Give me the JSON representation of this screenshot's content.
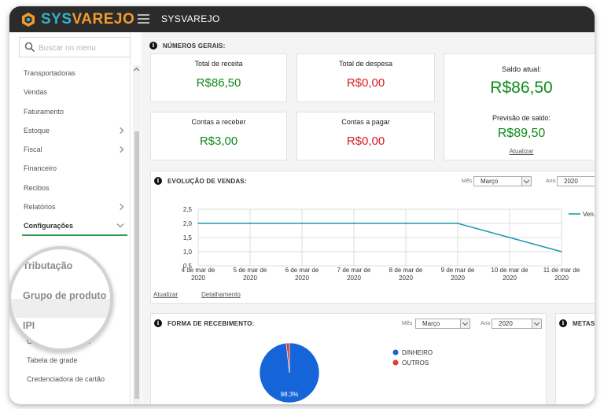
{
  "app": {
    "logo_part1": "SYS",
    "logo_part2": "VAREJO",
    "title": "SYSVAREJO"
  },
  "sidebar": {
    "search_placeholder": "Buscar no menu",
    "items": [
      {
        "label": "Transportadoras",
        "has_submenu": false
      },
      {
        "label": "Vendas",
        "has_submenu": false
      },
      {
        "label": "Faturamento",
        "has_submenu": false
      },
      {
        "label": "Estoque",
        "has_submenu": true
      },
      {
        "label": "Fiscal",
        "has_submenu": true
      },
      {
        "label": "Financeiro",
        "has_submenu": false
      },
      {
        "label": "Recibos",
        "has_submenu": false
      },
      {
        "label": "Relatórios",
        "has_submenu": true
      },
      {
        "label": "Configurações",
        "has_submenu": true,
        "active": true
      }
    ],
    "subitems": [
      {
        "label": "Categoria financeira"
      },
      {
        "label": "Tabela de grade"
      },
      {
        "label": "Credenciadora de cartão"
      }
    ],
    "magnified": [
      "Tributação",
      "Grupo de produto",
      "IPI"
    ]
  },
  "numeros_gerais": {
    "title": "NÚMEROS GERAIS:",
    "cards": {
      "total_receita": {
        "label": "Total de receita",
        "value": "R$86,50"
      },
      "total_despesa": {
        "label": "Total de despesa",
        "value": "R$0,00"
      },
      "contas_receber": {
        "label": "Contas a receber",
        "value": "R$3,00"
      },
      "contas_pagar": {
        "label": "Contas a pagar",
        "value": "R$0,00"
      }
    },
    "saldo": {
      "label": "Saldo atual:",
      "value": "R$86,50",
      "previsao_label": "Previsão de saldo:",
      "previsao_value": "R$89,50",
      "update_link": "Atualizar"
    },
    "colors": {
      "positive": "#0e8a1a",
      "negative": "#e0191e"
    }
  },
  "evolucao": {
    "title": "EVOLUÇÃO DE VENDAS:",
    "month_label": "Mês",
    "month_value": "Março",
    "year_label": "Ano",
    "year_value": "2020",
    "legend": "Ven...",
    "link_update": "Atualizar",
    "link_details": "Detalhamento"
  },
  "recebimento": {
    "title": "FORMA DE RECEBIMENTO:",
    "month_label": "Mês",
    "month_value": "Março",
    "year_label": "Ano",
    "year_value": "2020",
    "pie_label": "98.3%"
  },
  "metas": {
    "title": "METAS:"
  },
  "chart_data": [
    {
      "type": "line",
      "x": [
        "4 de mar de 2020",
        "5 de mar de 2020",
        "6 de mar de 2020",
        "7 de mar de 2020",
        "8 de mar de 2020",
        "9 de mar de 2020",
        "10 de mar de 2020",
        "11 de mar de 2020"
      ],
      "series": [
        {
          "name": "Ven...",
          "values": [
            2.0,
            2.0,
            2.0,
            2.0,
            2.0,
            2.0,
            1.5,
            1.0
          ],
          "color": "#1a9bb0"
        }
      ],
      "yticks": [
        "0,5",
        "1,0",
        "1,5",
        "2,0",
        "2,5"
      ],
      "ylim": [
        0.5,
        2.5
      ],
      "grid": true,
      "legend": "right"
    },
    {
      "type": "pie",
      "slices": [
        {
          "name": "DINHEIRO",
          "value": 98.3,
          "color": "#1565d8"
        },
        {
          "name": "OUTROS",
          "value": 1.7,
          "color": "#e53935"
        }
      ],
      "labels": [
        "98.3%"
      ],
      "legend": "right"
    }
  ]
}
